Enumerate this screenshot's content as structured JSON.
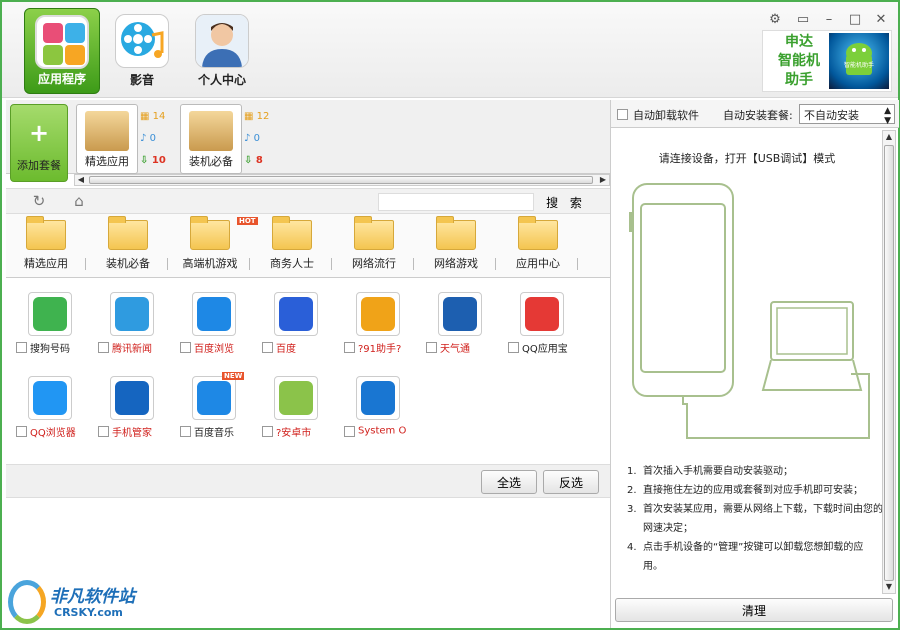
{
  "nav": {
    "tabs": [
      {
        "label": "应用程序",
        "icon": "apps-grid-icon"
      },
      {
        "label": "影音",
        "icon": "film-music-icon"
      },
      {
        "label": "个人中心",
        "icon": "user-avatar-icon"
      }
    ]
  },
  "brand": {
    "line1": "申达",
    "line2": "智能机",
    "line3": "助手",
    "robot_text": "智能机助手"
  },
  "packages": {
    "add_label": "添加套餐",
    "items": [
      {
        "label": "精选应用",
        "apps": "14",
        "media": "0",
        "downloads": "10"
      },
      {
        "label": "装机必备",
        "apps": "12",
        "media": "0",
        "downloads": "8"
      }
    ]
  },
  "toolbar": {
    "search_placeholder": "",
    "search_label": "搜 索"
  },
  "categories": [
    {
      "label": "精选应用"
    },
    {
      "label": "装机必备"
    },
    {
      "label": "高端机游戏",
      "badge": "HOT"
    },
    {
      "label": "商务人士"
    },
    {
      "label": "网络流行"
    },
    {
      "label": "网络游戏"
    },
    {
      "label": "应用中心"
    }
  ],
  "apps": [
    {
      "name": "搜狗号码",
      "red": false,
      "color": "#3fb34f"
    },
    {
      "name": "腾讯新闻",
      "red": true,
      "color": "#2f9be0"
    },
    {
      "name": "百度浏览",
      "red": true,
      "color": "#1e88e5"
    },
    {
      "name": "百度",
      "red": true,
      "color": "#2a5fd8"
    },
    {
      "name": "?91助手?",
      "red": true,
      "color": "#f0a318"
    },
    {
      "name": "天气通",
      "red": true,
      "color": "#1d5fb0"
    },
    {
      "name": "QQ应用宝",
      "red": false,
      "color": "#e53935"
    },
    {
      "name": "QQ浏览器",
      "red": true,
      "color": "#2196f3"
    },
    {
      "name": "手机管家",
      "red": true,
      "color": "#1565c0"
    },
    {
      "name": "百度音乐",
      "red": false,
      "color": "#1e88e5",
      "badge": "NEW"
    },
    {
      "name": "?安卓市",
      "red": true,
      "color": "#8bc34a"
    },
    {
      "name": "System O",
      "red": true,
      "color": "#1976d2"
    }
  ],
  "actions": {
    "select_all": "全选",
    "invert": "反选"
  },
  "right": {
    "auto_uninstall": "自动卸载软件",
    "auto_install_label": "自动安装套餐:",
    "auto_install_value": "不自动安装",
    "connect_hint": "请连接设备，打开【USB调试】模式",
    "steps": [
      {
        "n": "1.",
        "text": "首次插入手机需要自动安装驱动；"
      },
      {
        "n": "2.",
        "text": "直接拖住左边的应用或套餐到对应手机即可安装；"
      },
      {
        "n": "3.",
        "text": "首次安装某应用，需要从网络上下载，下载时间由您的网速决定；"
      },
      {
        "n": "4.",
        "text": "点击手机设备的“管理”按键可以卸载您想卸载的应用。"
      }
    ],
    "clear_label": "清理"
  },
  "watermark": {
    "title": "非凡软件站",
    "sub": "CRSKY.com"
  }
}
